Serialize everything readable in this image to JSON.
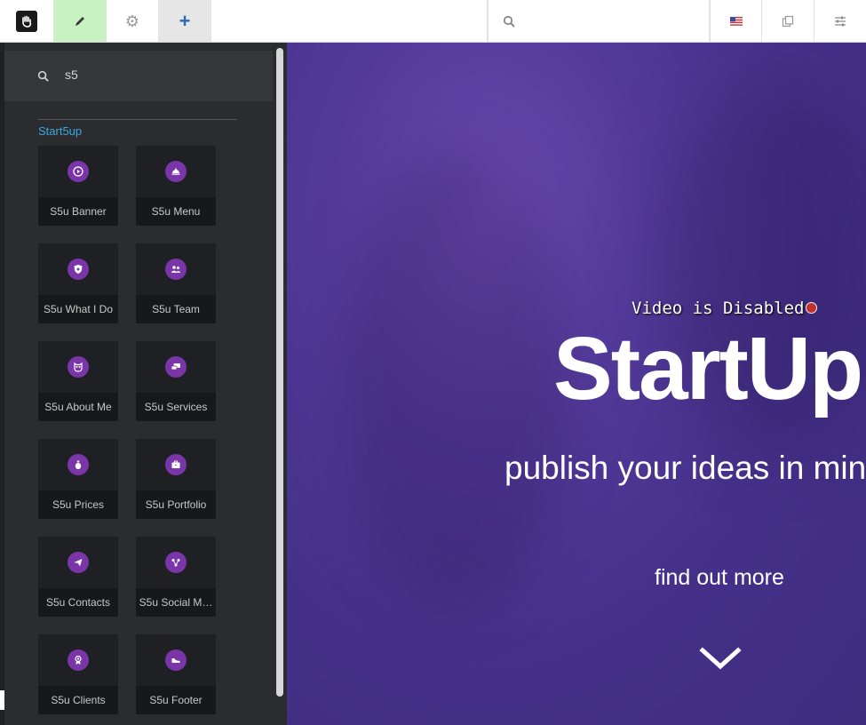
{
  "toolbar": {
    "search_placeholder": ""
  },
  "panel": {
    "search_value": "s5",
    "group_title": "Start5up",
    "tiles": [
      {
        "label": "S5u Banner",
        "icon": "play-circle-icon"
      },
      {
        "label": "S5u Menu",
        "icon": "cloche-icon"
      },
      {
        "label": "S5u What I Do",
        "icon": "shield-icon"
      },
      {
        "label": "S5u Team",
        "icon": "users-icon"
      },
      {
        "label": "S5u About Me",
        "icon": "owl-icon"
      },
      {
        "label": "S5u Services",
        "icon": "chat-icon"
      },
      {
        "label": "S5u Prices",
        "icon": "money-bag-icon"
      },
      {
        "label": "S5u Portfolio",
        "icon": "briefcase-icon"
      },
      {
        "label": "S5u Contacts",
        "icon": "paper-plane-icon"
      },
      {
        "label": "S5u Social M…",
        "icon": "share-nodes-icon"
      },
      {
        "label": "S5u Clients",
        "icon": "award-icon"
      },
      {
        "label": "S5u Footer",
        "icon": "shoe-icon"
      }
    ]
  },
  "hero": {
    "video_status": "Video is Disabled",
    "title": "StartUp",
    "subtitle": "publish your ideas in min",
    "link": "find out more"
  },
  "colors": {
    "accent_purple": "#7a36a8",
    "group_title_blue": "#3aa8e0",
    "edit_active_green": "#c9f2c3"
  }
}
